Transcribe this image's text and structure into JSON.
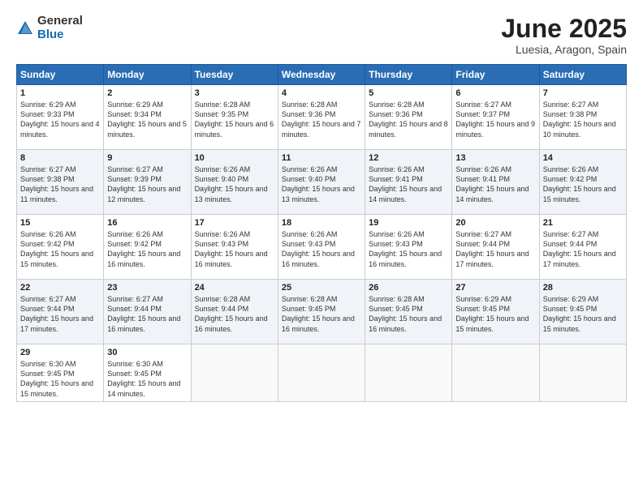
{
  "header": {
    "logo_general": "General",
    "logo_blue": "Blue",
    "title": "June 2025",
    "subtitle": "Luesia, Aragon, Spain"
  },
  "weekdays": [
    "Sunday",
    "Monday",
    "Tuesday",
    "Wednesday",
    "Thursday",
    "Friday",
    "Saturday"
  ],
  "weeks": [
    [
      {
        "day": "1",
        "sunrise": "6:29 AM",
        "sunset": "9:33 PM",
        "daylight": "15 hours and 4 minutes."
      },
      {
        "day": "2",
        "sunrise": "6:29 AM",
        "sunset": "9:34 PM",
        "daylight": "15 hours and 5 minutes."
      },
      {
        "day": "3",
        "sunrise": "6:28 AM",
        "sunset": "9:35 PM",
        "daylight": "15 hours and 6 minutes."
      },
      {
        "day": "4",
        "sunrise": "6:28 AM",
        "sunset": "9:36 PM",
        "daylight": "15 hours and 7 minutes."
      },
      {
        "day": "5",
        "sunrise": "6:28 AM",
        "sunset": "9:36 PM",
        "daylight": "15 hours and 8 minutes."
      },
      {
        "day": "6",
        "sunrise": "6:27 AM",
        "sunset": "9:37 PM",
        "daylight": "15 hours and 9 minutes."
      },
      {
        "day": "7",
        "sunrise": "6:27 AM",
        "sunset": "9:38 PM",
        "daylight": "15 hours and 10 minutes."
      }
    ],
    [
      {
        "day": "8",
        "sunrise": "6:27 AM",
        "sunset": "9:38 PM",
        "daylight": "15 hours and 11 minutes."
      },
      {
        "day": "9",
        "sunrise": "6:27 AM",
        "sunset": "9:39 PM",
        "daylight": "15 hours and 12 minutes."
      },
      {
        "day": "10",
        "sunrise": "6:26 AM",
        "sunset": "9:40 PM",
        "daylight": "15 hours and 13 minutes."
      },
      {
        "day": "11",
        "sunrise": "6:26 AM",
        "sunset": "9:40 PM",
        "daylight": "15 hours and 13 minutes."
      },
      {
        "day": "12",
        "sunrise": "6:26 AM",
        "sunset": "9:41 PM",
        "daylight": "15 hours and 14 minutes."
      },
      {
        "day": "13",
        "sunrise": "6:26 AM",
        "sunset": "9:41 PM",
        "daylight": "15 hours and 14 minutes."
      },
      {
        "day": "14",
        "sunrise": "6:26 AM",
        "sunset": "9:42 PM",
        "daylight": "15 hours and 15 minutes."
      }
    ],
    [
      {
        "day": "15",
        "sunrise": "6:26 AM",
        "sunset": "9:42 PM",
        "daylight": "15 hours and 15 minutes."
      },
      {
        "day": "16",
        "sunrise": "6:26 AM",
        "sunset": "9:42 PM",
        "daylight": "15 hours and 16 minutes."
      },
      {
        "day": "17",
        "sunrise": "6:26 AM",
        "sunset": "9:43 PM",
        "daylight": "15 hours and 16 minutes."
      },
      {
        "day": "18",
        "sunrise": "6:26 AM",
        "sunset": "9:43 PM",
        "daylight": "15 hours and 16 minutes."
      },
      {
        "day": "19",
        "sunrise": "6:26 AM",
        "sunset": "9:43 PM",
        "daylight": "15 hours and 16 minutes."
      },
      {
        "day": "20",
        "sunrise": "6:27 AM",
        "sunset": "9:44 PM",
        "daylight": "15 hours and 17 minutes."
      },
      {
        "day": "21",
        "sunrise": "6:27 AM",
        "sunset": "9:44 PM",
        "daylight": "15 hours and 17 minutes."
      }
    ],
    [
      {
        "day": "22",
        "sunrise": "6:27 AM",
        "sunset": "9:44 PM",
        "daylight": "15 hours and 17 minutes."
      },
      {
        "day": "23",
        "sunrise": "6:27 AM",
        "sunset": "9:44 PM",
        "daylight": "15 hours and 16 minutes."
      },
      {
        "day": "24",
        "sunrise": "6:28 AM",
        "sunset": "9:44 PM",
        "daylight": "15 hours and 16 minutes."
      },
      {
        "day": "25",
        "sunrise": "6:28 AM",
        "sunset": "9:45 PM",
        "daylight": "15 hours and 16 minutes."
      },
      {
        "day": "26",
        "sunrise": "6:28 AM",
        "sunset": "9:45 PM",
        "daylight": "15 hours and 16 minutes."
      },
      {
        "day": "27",
        "sunrise": "6:29 AM",
        "sunset": "9:45 PM",
        "daylight": "15 hours and 15 minutes."
      },
      {
        "day": "28",
        "sunrise": "6:29 AM",
        "sunset": "9:45 PM",
        "daylight": "15 hours and 15 minutes."
      }
    ],
    [
      {
        "day": "29",
        "sunrise": "6:30 AM",
        "sunset": "9:45 PM",
        "daylight": "15 hours and 15 minutes."
      },
      {
        "day": "30",
        "sunrise": "6:30 AM",
        "sunset": "9:45 PM",
        "daylight": "15 hours and 14 minutes."
      },
      null,
      null,
      null,
      null,
      null
    ]
  ]
}
